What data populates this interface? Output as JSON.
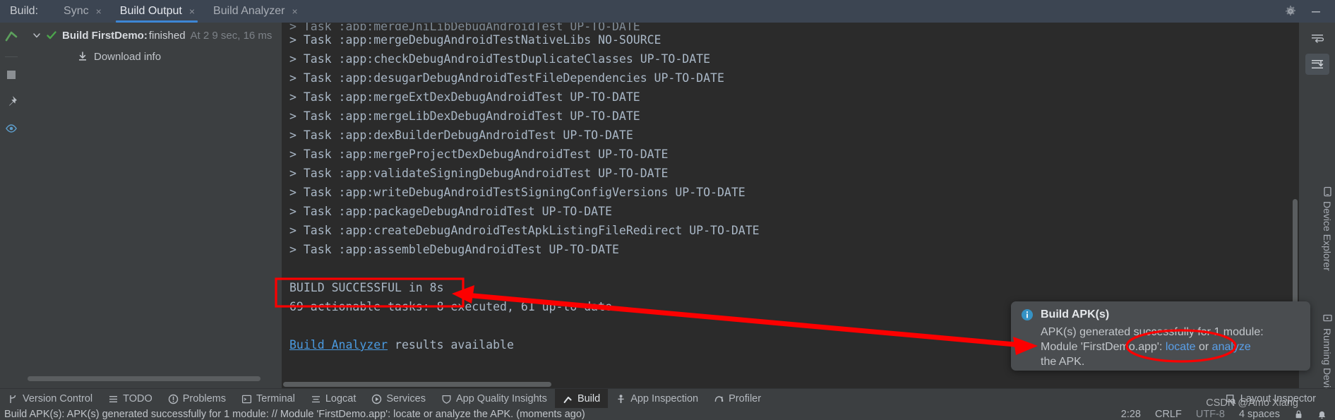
{
  "window": {
    "build_label": "Build:",
    "tabs": [
      {
        "label": "Sync",
        "close": "×",
        "active": false
      },
      {
        "label": "Build Output",
        "close": "×",
        "active": true
      },
      {
        "label": "Build Analyzer",
        "close": "×",
        "active": false
      }
    ],
    "settings_icon": "gear-icon",
    "minimize_icon": "minimize-icon"
  },
  "left_strip": {
    "icons": [
      {
        "name": "build-run-icon"
      },
      {
        "name": "stop-icon"
      },
      {
        "name": "pin-icon"
      },
      {
        "name": "eye-icon"
      }
    ]
  },
  "tree": {
    "expand_icon": "chevron-down-icon",
    "status_icon": "green-check-icon",
    "build_name": "Build FirstDemo:",
    "build_state": "finished",
    "build_time": "At 2 9 sec, 16 ms",
    "download_icon": "download-icon",
    "download_label": "Download info"
  },
  "console": {
    "top_clipped_line": "> Task :app:mergeJniLibDebugAndroidTest UP-TO-DATE",
    "lines": [
      "> Task :app:mergeDebugAndroidTestNativeLibs NO-SOURCE",
      "> Task :app:checkDebugAndroidTestDuplicateClasses UP-TO-DATE",
      "> Task :app:desugarDebugAndroidTestFileDependencies UP-TO-DATE",
      "> Task :app:mergeExtDexDebugAndroidTest UP-TO-DATE",
      "> Task :app:mergeLibDexDebugAndroidTest UP-TO-DATE",
      "> Task :app:dexBuilderDebugAndroidTest UP-TO-DATE",
      "> Task :app:mergeProjectDexDebugAndroidTest UP-TO-DATE",
      "> Task :app:validateSigningDebugAndroidTest UP-TO-DATE",
      "> Task :app:writeDebugAndroidTestSigningConfigVersions UP-TO-DATE",
      "> Task :app:packageDebugAndroidTest UP-TO-DATE",
      "> Task :app:createDebugAndroidTestApkListingFileRedirect UP-TO-DATE",
      "> Task :app:assembleDebugAndroidTest UP-TO-DATE"
    ],
    "build_successful": "BUILD SUCCESSFUL in 8s",
    "actionable_tasks": "69 actionable tasks: 8 executed, 61 up-to-date",
    "analyzer_link": "Build Analyzer",
    "analyzer_suffix": " results available",
    "toolbar_icons": [
      {
        "name": "soft-wrap-icon"
      },
      {
        "name": "scroll-to-end-icon"
      }
    ]
  },
  "right_strip": {
    "device_explorer": "Device Explorer",
    "running_devices": "Running Devices"
  },
  "balloon": {
    "info_icon": "info-icon",
    "title": "Build APK(s)",
    "line1": "APK(s) generated successfully for 1 module:",
    "line2_prefix": "Module 'FirstDemo.app': ",
    "link_locate": "locate",
    "line2_mid": " or ",
    "link_analyze": "analyze",
    "line3": "the APK."
  },
  "bottom_bar": {
    "items": [
      {
        "label": "Version Control",
        "icon": "branch-icon",
        "active": false
      },
      {
        "label": "TODO",
        "icon": "list-icon",
        "active": false
      },
      {
        "label": "Problems",
        "icon": "error-icon",
        "active": false
      },
      {
        "label": "Terminal",
        "icon": "terminal-icon",
        "active": false
      },
      {
        "label": "Logcat",
        "icon": "logcat-icon",
        "active": false
      },
      {
        "label": "Services",
        "icon": "services-icon",
        "active": false
      },
      {
        "label": "App Quality Insights",
        "icon": "shield-icon",
        "active": false
      },
      {
        "label": "Build",
        "icon": "hammer-icon",
        "active": true
      },
      {
        "label": "App Inspection",
        "icon": "inspection-icon",
        "active": false
      },
      {
        "label": "Profiler",
        "icon": "profiler-icon",
        "active": false
      }
    ],
    "layout_inspector": {
      "label": "Layout Inspector",
      "icon": "layout-inspector-icon"
    }
  },
  "status_bar": {
    "message": "Build APK(s): APK(s) generated successfully for 1 module: // Module 'FirstDemo.app': locate or analyze the APK. (moments ago)",
    "caret_position": "2:28",
    "line_separator": "CRLF",
    "encoding": "UTF-8",
    "indent": "4 spaces",
    "lock_icon": "lock-icon",
    "notification_icon": "notifications-icon"
  },
  "watermark": "CSDN @Amo Xiang",
  "colors": {
    "accent_blue": "#3d86d4",
    "link_blue": "#5a9fe8",
    "annotation_red": "#fd0000",
    "console_bg": "#2b2b2b",
    "panel_bg": "#3c3f41",
    "tabbar_bg": "#3c4552",
    "success_green": "#4ca54c"
  }
}
